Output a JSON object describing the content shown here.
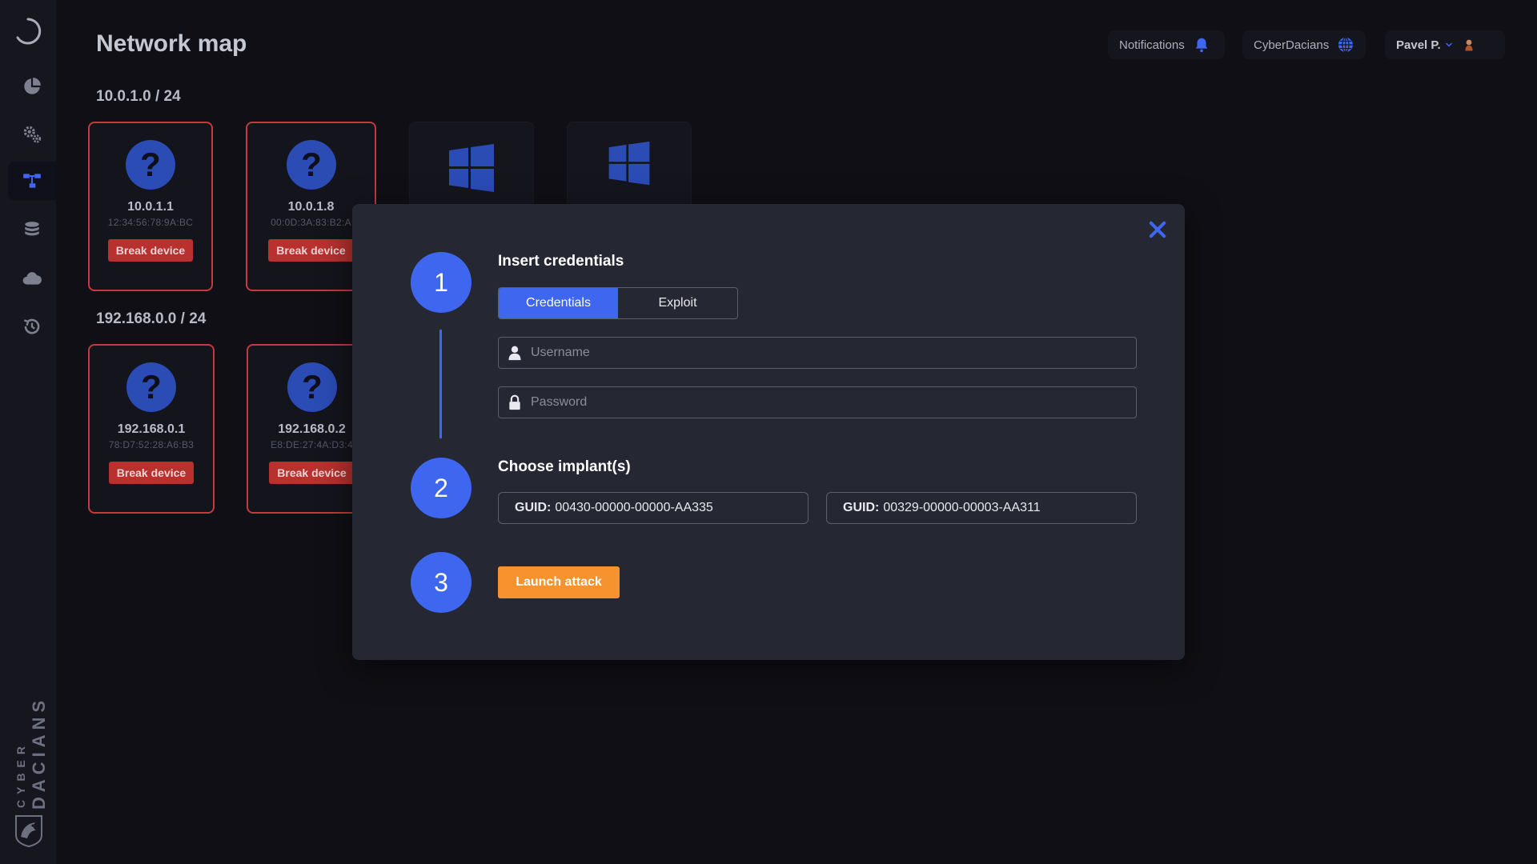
{
  "header": {
    "title": "Network map",
    "notifications_label": "Notifications",
    "team_label": "CyberDacians",
    "user_label": "Pavel P."
  },
  "sidebar": {
    "items": [
      {
        "icon": "pie-chart-icon"
      },
      {
        "icon": "gears-icon"
      },
      {
        "icon": "network-map-icon",
        "active": true
      },
      {
        "icon": "database-icon"
      },
      {
        "icon": "cloud-icon"
      },
      {
        "icon": "history-icon"
      }
    ],
    "brand_word1": "CYBER",
    "brand_word2": "DACIANS"
  },
  "subnets": [
    {
      "label": "10.0.1.0 / 24",
      "devices": [
        {
          "ip": "10.0.1.1",
          "mac": "12:34:56:78:9A:BC",
          "action": "Break device",
          "icon": "question-icon"
        },
        {
          "ip": "10.0.1.8",
          "mac": "00:0D:3A:83:B2:A",
          "action": "Break device",
          "icon": "question-icon"
        },
        {
          "icon": "windows-icon"
        },
        {
          "icon": "windows-icon"
        }
      ]
    },
    {
      "label": "192.168.0.0 / 24",
      "devices": [
        {
          "ip": "192.168.0.1",
          "mac": "78:D7:52:28:A6:B3",
          "action": "Break device",
          "icon": "question-icon"
        },
        {
          "ip": "192.168.0.2",
          "mac": "E8:DE:27:4A:D3:4",
          "action": "Break device",
          "icon": "question-icon"
        }
      ]
    }
  ],
  "modal": {
    "step1": {
      "number": "1",
      "title": "Insert credentials",
      "tabs": [
        {
          "label": "Credentials",
          "active": true
        },
        {
          "label": "Exploit",
          "active": false
        }
      ],
      "username_placeholder": "Username",
      "password_placeholder": "Password"
    },
    "step2": {
      "number": "2",
      "title": "Choose implant(s)",
      "implants": [
        {
          "key": "GUID:",
          "value": "00430-00000-00000-AA335"
        },
        {
          "key": "GUID:",
          "value": "00329-00000-00003-AA311"
        }
      ]
    },
    "step3": {
      "number": "3",
      "launch_label": "Launch attack"
    }
  },
  "colors": {
    "accent": "#3f66ee",
    "danger": "#b8312f",
    "launch": "#f7932e",
    "background": "#0f0f15"
  }
}
